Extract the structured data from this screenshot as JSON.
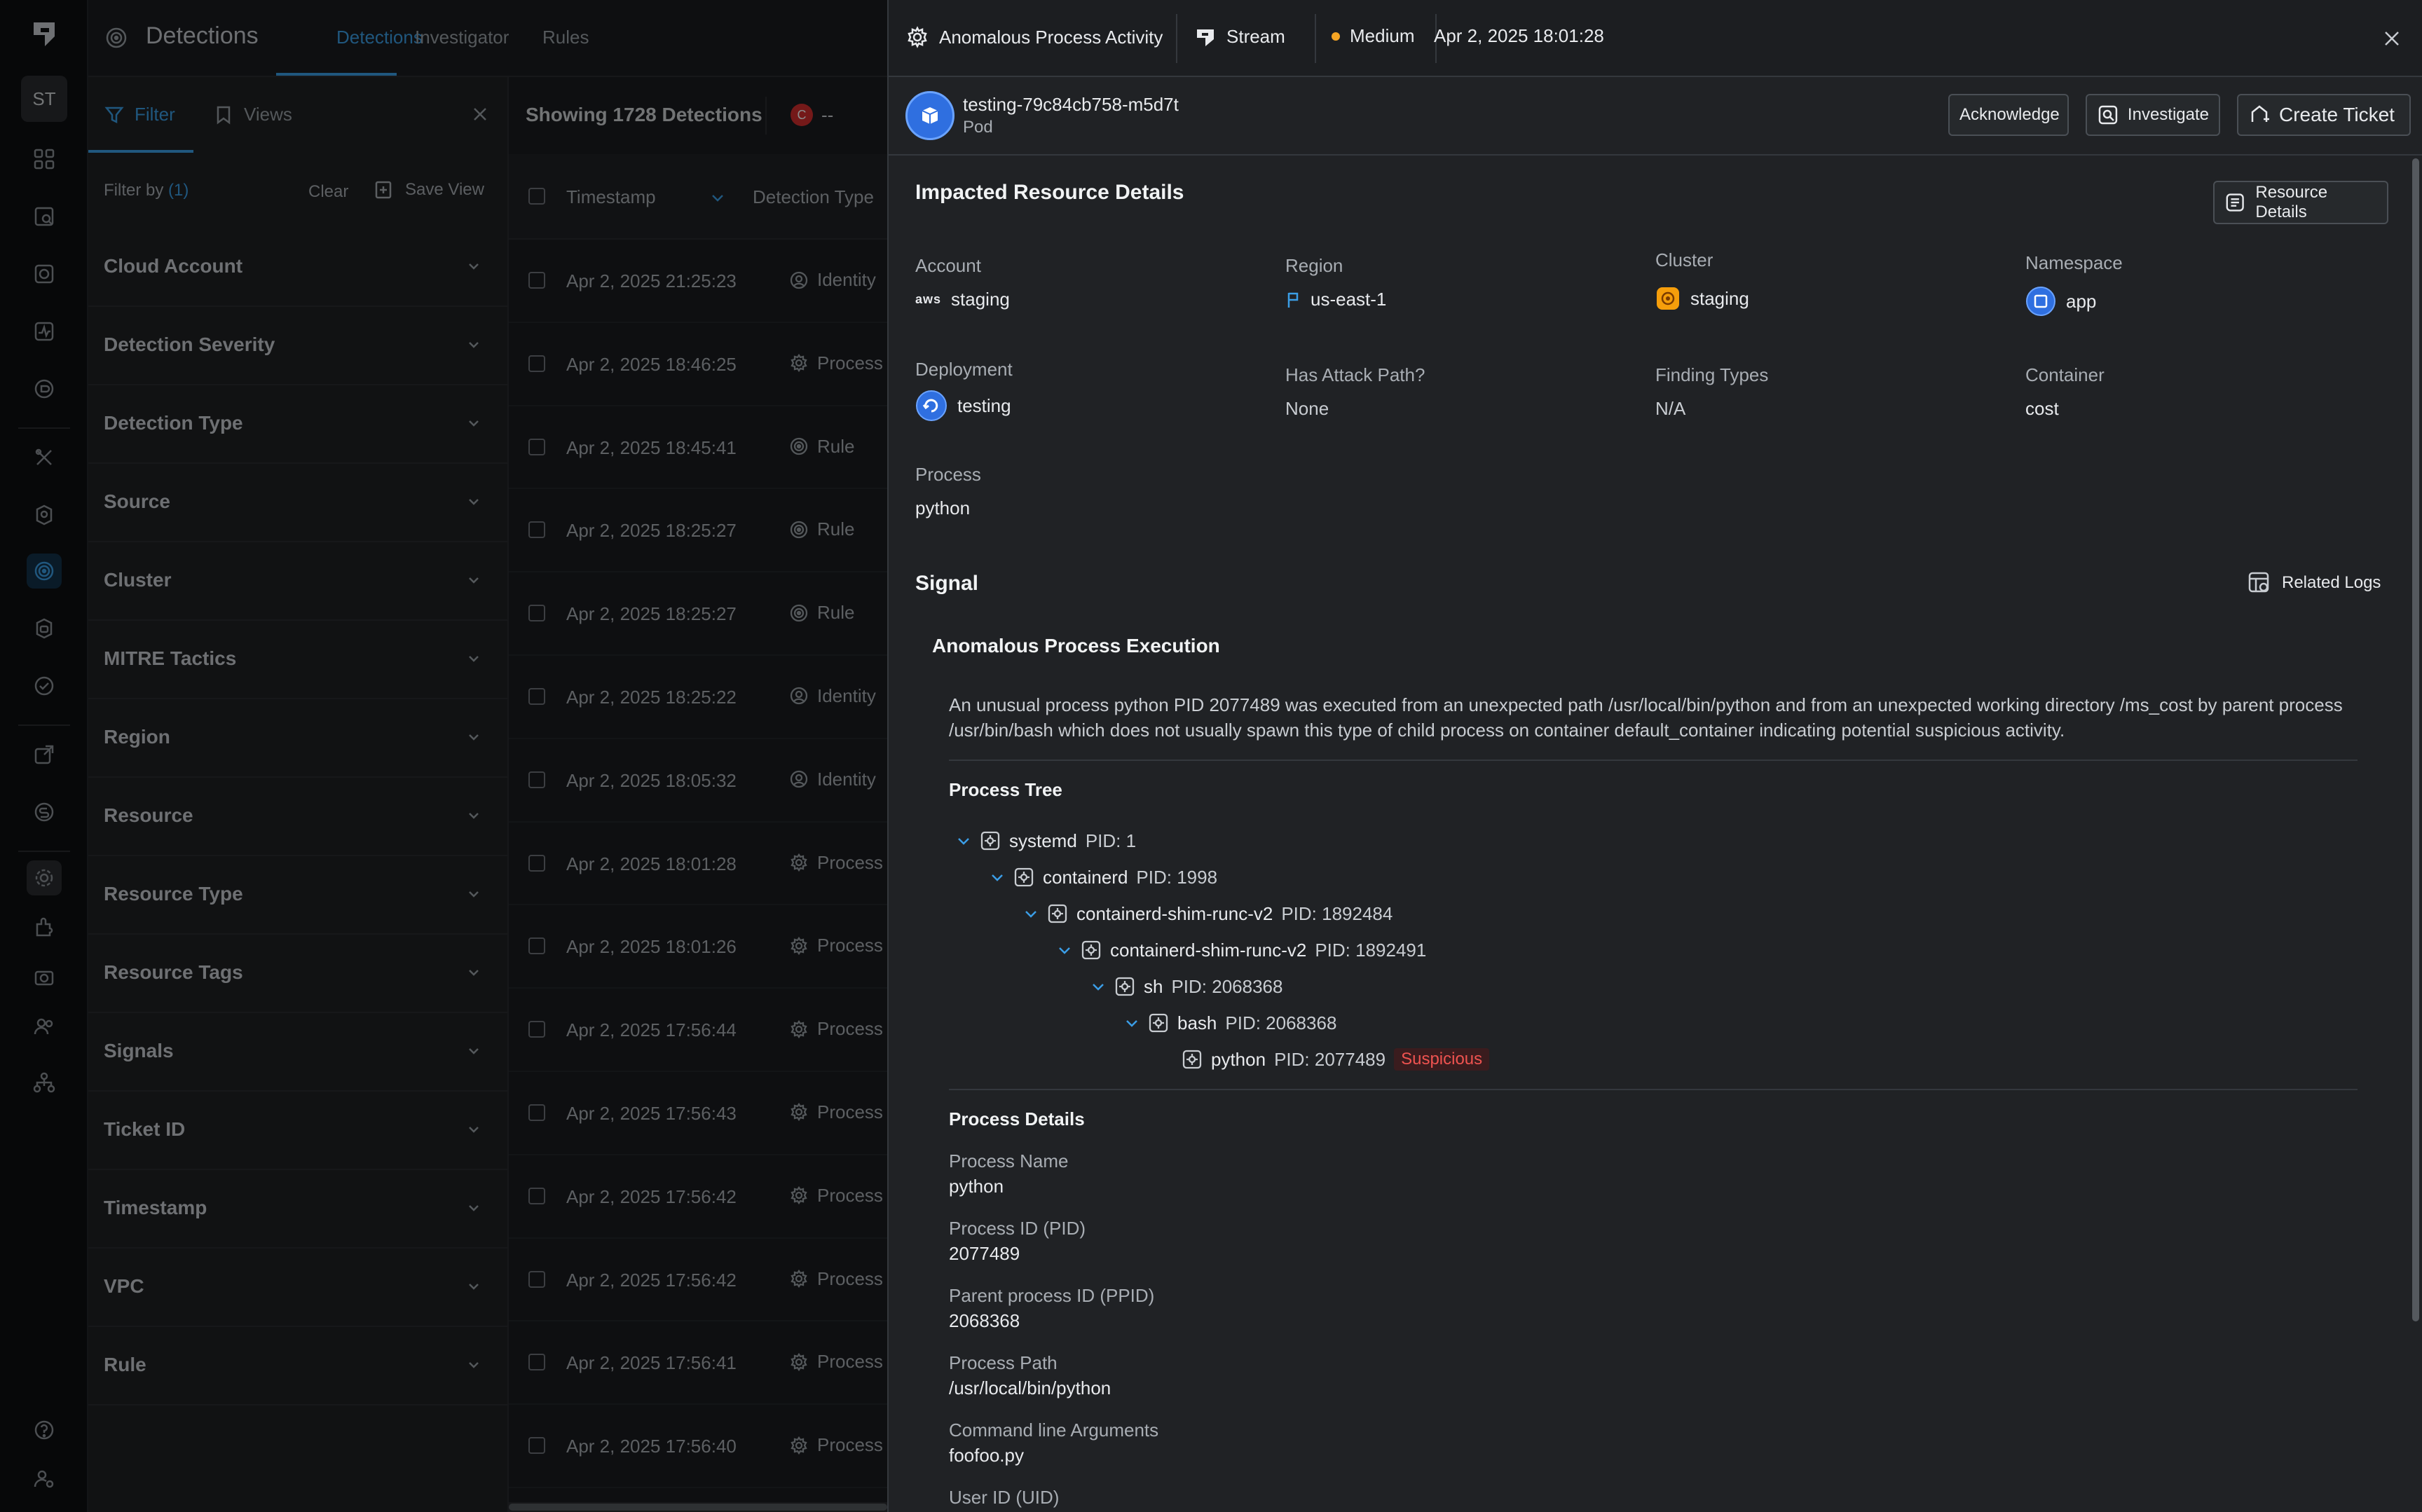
{
  "colors": {
    "accent": "#3b9ee6",
    "severity_medium": "#f5a524",
    "suspicious": "#ef5350",
    "critical": "#d32f2f",
    "pod_blue": "#2f6fe0"
  },
  "rail": {
    "avatar": "ST",
    "icons": [
      "logo-icon",
      "dashboard-icon",
      "inventory-icon",
      "vulnerability-icon",
      "activity-icon",
      "posture-icon",
      "tools-icon",
      "identity-icon",
      "detections-icon",
      "security-icon",
      "compliance-icon",
      "export-icon",
      "cost-icon",
      "settings-icon",
      "integrations-icon",
      "camera-icon",
      "users-icon",
      "org-icon",
      "help-icon",
      "user-settings-icon"
    ]
  },
  "topbar": {
    "title": "Detections",
    "tabs": [
      "Detections",
      "Investigator",
      "Rules"
    ]
  },
  "filter_panel": {
    "tab_filter": "Filter",
    "tab_views": "Views",
    "filter_by": "Filter by",
    "filter_count": "(1)",
    "clear": "Clear",
    "save_view": "Save View",
    "rows": [
      "Cloud Account",
      "Detection Severity",
      "Detection Type",
      "Source",
      "Cluster",
      "MITRE Tactics",
      "Region",
      "Resource",
      "Resource Type",
      "Resource Tags",
      "Signals",
      "Ticket ID",
      "Timestamp",
      "VPC",
      "Rule"
    ]
  },
  "table": {
    "header": "Showing 1728 Detections",
    "badge_letter": "C",
    "badge_value": "--",
    "col_timestamp": "Timestamp",
    "col_type": "Detection Type",
    "rows": [
      {
        "ts": "Apr 2, 2025 21:25:23",
        "type": "Identity",
        "icon": "identity-icon"
      },
      {
        "ts": "Apr 2, 2025 18:46:25",
        "type": "Process Activ",
        "icon": "gear-icon"
      },
      {
        "ts": "Apr 2, 2025 18:45:41",
        "type": "Rule",
        "icon": "rule-icon"
      },
      {
        "ts": "Apr 2, 2025 18:25:27",
        "type": "Rule",
        "icon": "rule-icon"
      },
      {
        "ts": "Apr 2, 2025 18:25:27",
        "type": "Rule",
        "icon": "rule-icon"
      },
      {
        "ts": "Apr 2, 2025 18:25:22",
        "type": "Identity",
        "icon": "identity-icon"
      },
      {
        "ts": "Apr 2, 2025 18:05:32",
        "type": "Identity",
        "icon": "identity-icon"
      },
      {
        "ts": "Apr 2, 2025 18:01:28",
        "type": "Process Activ",
        "icon": "gear-icon"
      },
      {
        "ts": "Apr 2, 2025 18:01:26",
        "type": "Process Activ",
        "icon": "gear-icon"
      },
      {
        "ts": "Apr 2, 2025 17:56:44",
        "type": "Process Activ",
        "icon": "gear-icon"
      },
      {
        "ts": "Apr 2, 2025 17:56:43",
        "type": "Process Activ",
        "icon": "gear-icon"
      },
      {
        "ts": "Apr 2, 2025 17:56:42",
        "type": "Process Activ",
        "icon": "gear-icon"
      },
      {
        "ts": "Apr 2, 2025 17:56:42",
        "type": "Process Activ",
        "icon": "gear-icon"
      },
      {
        "ts": "Apr 2, 2025 17:56:41",
        "type": "Process Activ",
        "icon": "gear-icon"
      },
      {
        "ts": "Apr 2, 2025 17:56:40",
        "type": "Process Activ",
        "icon": "gear-icon"
      }
    ]
  },
  "drawer": {
    "title": "Anomalous Process Activity",
    "source": "Stream",
    "severity": "Medium",
    "timestamp": "Apr 2, 2025 18:01:28",
    "resource_name": "testing-79c84cb758-m5d7t",
    "resource_type": "Pod",
    "acknowledge": "Acknowledge",
    "investigate": "Investigate",
    "create_ticket": "Create Ticket"
  },
  "impacted": {
    "title": "Impacted Resource Details",
    "resource_details_btn": "Resource Details",
    "account_label": "Account",
    "account_value": "staging",
    "account_provider": "aws",
    "region_label": "Region",
    "region_value": "us-east-1",
    "cluster_label": "Cluster",
    "cluster_value": "staging",
    "namespace_label": "Namespace",
    "namespace_value": "app",
    "deployment_label": "Deployment",
    "deployment_value": "testing",
    "attack_path_label": "Has Attack Path?",
    "attack_path_value": "None",
    "finding_types_label": "Finding Types",
    "finding_types_value": "N/A",
    "container_label": "Container",
    "container_value": "cost",
    "process_label": "Process",
    "process_value": "python"
  },
  "signal": {
    "title": "Signal",
    "related_logs": "Related Logs",
    "name": "Anomalous Process Execution",
    "description": "An unusual process python PID 2077489 was executed from an unexpected path /usr/local/bin/python and from an unexpected working directory /ms_cost by parent process /usr/bin/bash which does not usually spawn this type of child process on container default_container indicating potential suspicious activity.",
    "process_tree_title": "Process Tree",
    "tree": [
      {
        "name": "systemd",
        "pid": "PID: 1"
      },
      {
        "name": "containerd",
        "pid": "PID: 1998"
      },
      {
        "name": "containerd-shim-runc-v2",
        "pid": "PID: 1892484"
      },
      {
        "name": "containerd-shim-runc-v2",
        "pid": "PID: 1892491"
      },
      {
        "name": "sh",
        "pid": "PID: 2068368"
      },
      {
        "name": "bash",
        "pid": "PID: 2068368"
      },
      {
        "name": "python",
        "pid": "PID: 2077489",
        "tag": "Suspicious"
      }
    ],
    "process_details_title": "Process Details",
    "details": [
      {
        "label": "Process Name",
        "value": "python"
      },
      {
        "label": "Process ID (PID)",
        "value": "2077489"
      },
      {
        "label": "Parent process ID (PPID)",
        "value": "2068368"
      },
      {
        "label": "Process Path",
        "value": "/usr/local/bin/python"
      },
      {
        "label": "Command line Arguments",
        "value": "foofoo.py"
      },
      {
        "label": "User ID (UID)",
        "value": ""
      }
    ]
  }
}
